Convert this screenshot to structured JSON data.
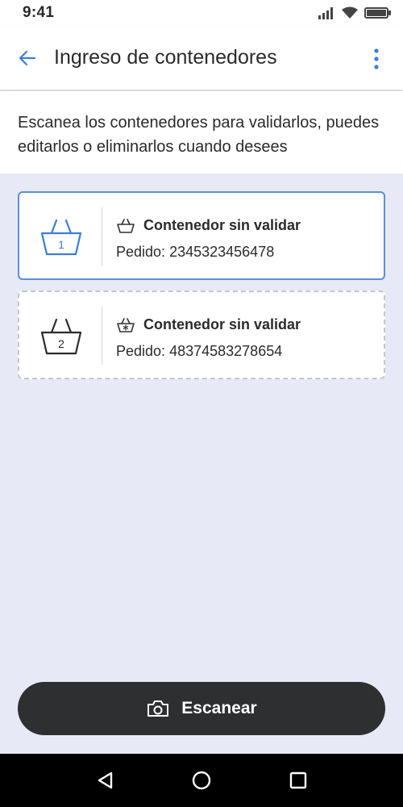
{
  "status_bar": {
    "time": "9:41",
    "icons": [
      "signal-icon",
      "wifi-icon",
      "battery-icon"
    ]
  },
  "app_bar": {
    "title": "Ingreso de contenedores",
    "back_icon": "arrow-left-icon",
    "menu_icon": "more-vertical-icon"
  },
  "intro": {
    "text": "Escanea los contenedores para validarlos, puedes editarlos o eliminarlos cuando desees"
  },
  "containers": [
    {
      "number": "1",
      "status_icon": "basket-icon",
      "title": "Contenedor sin validar",
      "order_label": "Pedido:",
      "order_number": "2345323456478"
    },
    {
      "number": "2",
      "status_icon": "basket-frozen-icon",
      "title": "Contenedor sin validar",
      "order_label": "Pedido:",
      "order_number": "48374583278654"
    }
  ],
  "scan_button": {
    "label": "Escanear",
    "icon": "camera-icon"
  },
  "nav_bar": {
    "icons": [
      "back-triangle-icon",
      "home-circle-icon",
      "recents-square-icon"
    ]
  },
  "colors": {
    "accent": "#3b7dd8",
    "selected_border": "#5b8fd6",
    "background": "#e8e9f7",
    "button": "#2e2f31"
  }
}
